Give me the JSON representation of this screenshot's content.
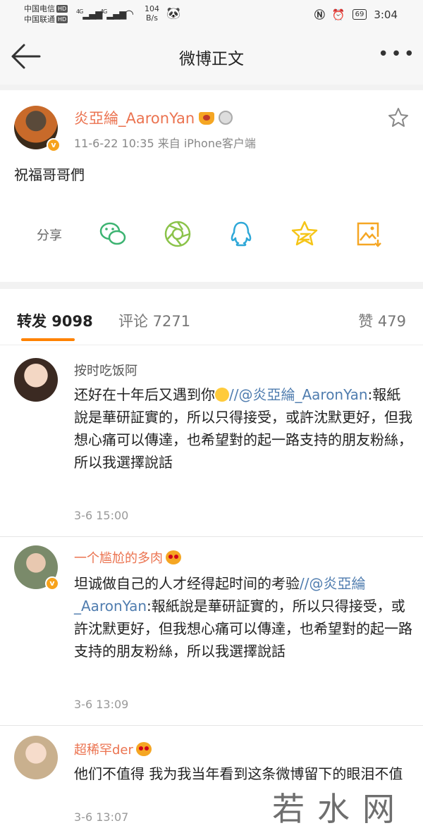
{
  "status_bar": {
    "carrier1": "中国电信",
    "carrier2": "中国联通",
    "hd": "HD",
    "net1": "4G",
    "net2": "4G",
    "speed_value": "104",
    "speed_unit": "B/s",
    "battery": "69",
    "time": "3:04"
  },
  "nav": {
    "title": "微博正文"
  },
  "post": {
    "author": "炎亞綸_AaronYan",
    "meta": "11-6-22 10:35  来自 iPhone客户端",
    "text": "祝福哥哥們",
    "share_label": "分享"
  },
  "tabs": {
    "repost": "转发 9098",
    "comment": "评论 7271",
    "like": "赞 479"
  },
  "reposts": [
    {
      "name": "按时吃饭阿",
      "text_plain": "还好在十年后又遇到你",
      "text_link": "//@炎亞綸_AaronYan",
      "text_rest": ":報紙說是華研証實的，所以只得接受，或許沈默更好，但我想心痛可以傳達，也希望對的起一路支持的朋友粉絲，所以我選擇說話",
      "time": "3-6 15:00"
    },
    {
      "name": "一个尴尬的多肉",
      "text_plain": "坦诚做自己的人才经得起时间的考验",
      "text_link": "//@炎亞綸_AaronYan",
      "text_rest": ":報紙說是華研証實的，所以只得接受，或許沈默更好，但我想心痛可以傳達，也希望對的起一路支持的朋友粉絲，所以我選擇說話",
      "time": "3-6 13:09"
    },
    {
      "name": "超稀罕der",
      "text_plain": "他们不值得 我为我当年看到这条微博留下的眼泪不值",
      "time": "3-6 13:07"
    }
  ],
  "watermark": "若水网",
  "colors": {
    "accent_orange": "#ff8200",
    "name_orange": "#eb7350",
    "link_blue": "#507daf",
    "wechat_green": "#3cb371",
    "moments_green": "#8bc34a",
    "qq_blue": "#2fa8d8",
    "qzone_yellow": "#f5c518"
  }
}
